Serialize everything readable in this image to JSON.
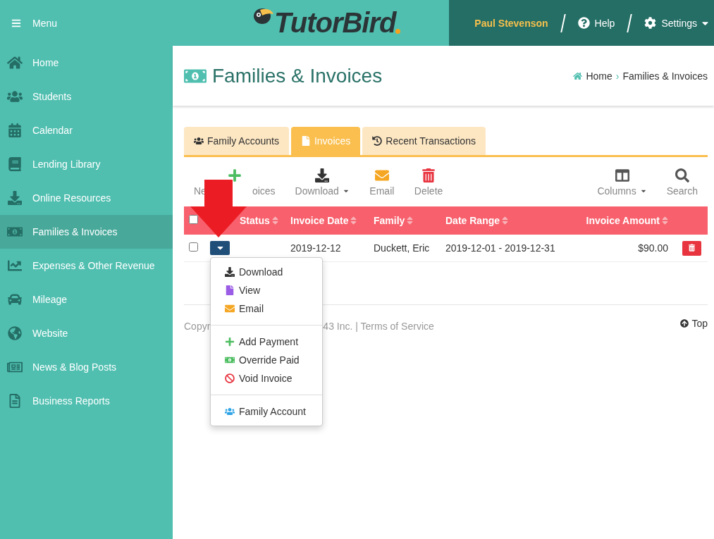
{
  "header": {
    "menu_label": "Menu",
    "brand": "TutorBird",
    "user": "Paul Stevenson",
    "help": "Help",
    "settings": "Settings"
  },
  "sidebar": {
    "items": [
      {
        "label": "Home",
        "selected": false
      },
      {
        "label": "Students",
        "selected": false
      },
      {
        "label": "Calendar",
        "selected": false
      },
      {
        "label": "Lending Library",
        "selected": false
      },
      {
        "label": "Online Resources",
        "selected": false
      },
      {
        "label": "Families & Invoices",
        "selected": true
      },
      {
        "label": "Expenses & Other Revenue",
        "selected": false
      },
      {
        "label": "Mileage",
        "selected": false
      },
      {
        "label": "Website",
        "selected": false
      },
      {
        "label": "News & Blog Posts",
        "selected": false
      },
      {
        "label": "Business Reports",
        "selected": false
      }
    ]
  },
  "page": {
    "title": "Families & Invoices",
    "breadcrumb": [
      "Home",
      "Families & Invoices"
    ],
    "separator": "›"
  },
  "tabs": [
    {
      "label": "Family Accounts",
      "selected": false
    },
    {
      "label": "Invoices",
      "selected": true
    },
    {
      "label": "Recent Transactions",
      "selected": false
    }
  ],
  "toolbar": {
    "left": [
      {
        "parts": [
          "Ne",
          "oices"
        ],
        "menu": false
      },
      {
        "label": "Download",
        "menu": true
      },
      {
        "label": "Email",
        "menu": false
      },
      {
        "label": "Delete",
        "menu": false
      }
    ],
    "right": [
      {
        "label": "Columns",
        "menu": true
      },
      {
        "label": "Search",
        "menu": false
      }
    ]
  },
  "table": {
    "all_checked": false,
    "columns": [
      "Status",
      "Invoice Date",
      "Family",
      "Date Range",
      "Invoice Amount"
    ],
    "rows": [
      {
        "checked": false,
        "date": "2019-12-12",
        "family": "Duckett, Eric",
        "range": "2019-12-01 - 2019-12-31",
        "amount": "$90.00"
      }
    ]
  },
  "row_menu": {
    "groups": [
      [
        {
          "label": "Download"
        },
        {
          "label": "View"
        },
        {
          "label": "Email"
        }
      ],
      [
        {
          "label": "Add Payment"
        },
        {
          "label": "Override Paid"
        },
        {
          "label": "Void Invoice"
        }
      ],
      [
        {
          "label": "Family Account"
        }
      ]
    ]
  },
  "footer": {
    "parts": [
      "Copyr",
      "43 Inc. | Terms of Service"
    ],
    "top": "Top"
  }
}
